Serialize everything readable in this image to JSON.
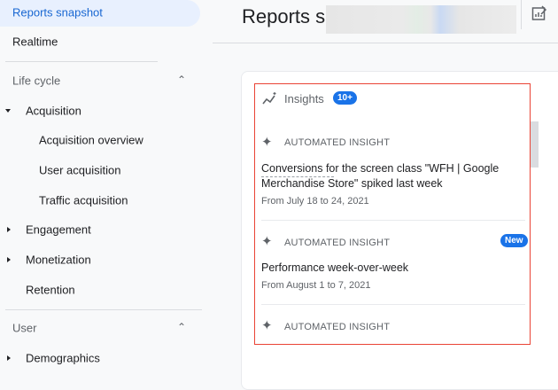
{
  "sidebar": {
    "selected": "Reports snapshot",
    "realtime": "Realtime",
    "lifecycle": "Life cycle",
    "acquisition": "Acquisition",
    "acq_items": [
      "Acquisition overview",
      "User acquisition",
      "Traffic acquisition"
    ],
    "engagement": "Engagement",
    "monetization": "Monetization",
    "retention": "Retention",
    "user": "User",
    "demographics": "Demographics"
  },
  "header": {
    "title": "Reports sn"
  },
  "insights": {
    "title": "Insights",
    "count": "10+",
    "items": [
      {
        "label": "AUTOMATED INSIGHT",
        "headline": "Conversions for the screen class \"WFH | Google Merchandise Store\" spiked last week",
        "date": "From July 18 to 24, 2021"
      },
      {
        "label": "AUTOMATED INSIGHT",
        "badge": "New",
        "headline": "Performance week-over-week",
        "date": "From August 1 to 7, 2021"
      },
      {
        "label": "AUTOMATED INSIGHT"
      }
    ]
  }
}
